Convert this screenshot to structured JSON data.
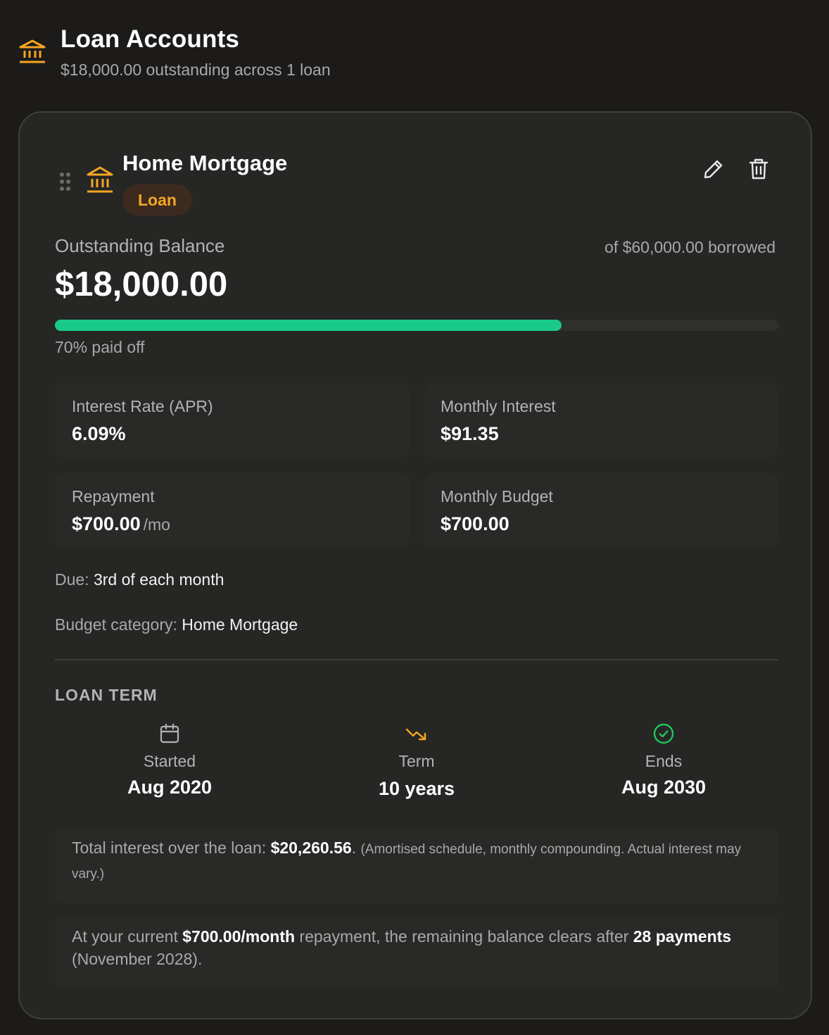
{
  "header": {
    "title": "Loan Accounts",
    "subtitle": "$18,000.00 outstanding across 1 loan"
  },
  "colors": {
    "accent": "#f5a623",
    "progress": "#19c98a",
    "success": "#22c55e",
    "background": "#1c1b1a",
    "card": "#262625"
  },
  "loan": {
    "name": "Home Mortgage",
    "type_badge": "Loan",
    "icon": "bank-icon",
    "actions": {
      "edit_icon": "pencil-icon",
      "delete_icon": "trash-icon"
    },
    "balance_label": "Outstanding Balance",
    "balance": "$18,000.00",
    "borrowed": "of $60,000.00 borrowed",
    "paid_fraction": 0.7,
    "paid_off_text": "70% paid off",
    "stats": {
      "interest_rate": {
        "label": "Interest Rate (APR)",
        "value": "6.09%"
      },
      "monthly_interest": {
        "label": "Monthly Interest",
        "value": "$91.35"
      },
      "repayment": {
        "label": "Repayment",
        "value": "$700.00",
        "unit": "/mo"
      },
      "monthly_budget": {
        "label": "Monthly Budget",
        "value": "$700.00"
      }
    },
    "due": {
      "label": "Due:",
      "value": "3rd of each month"
    },
    "budget_category": {
      "label": "Budget category:",
      "value": "Home Mortgage"
    },
    "term_section": {
      "title": "LOAN TERM",
      "started": {
        "icon": "calendar-icon",
        "label": "Started",
        "value": "Aug 2020"
      },
      "term": {
        "icon": "trending-down-icon",
        "label": "Term",
        "value": "10 years"
      },
      "ends": {
        "icon": "check-circle-icon",
        "label": "Ends",
        "value": "Aug 2030"
      }
    },
    "total_interest_note": {
      "prefix": "Total interest over the loan:",
      "amount": "$20,260.56",
      "suffix": ".",
      "disclaimer": "(Amortised schedule, monthly compounding. Actual interest may vary.)"
    },
    "payoff_note": {
      "prefix": "At your current",
      "amount": "$700.00/month",
      "middle": "repayment, the remaining balance clears after",
      "payments": "28 payments",
      "date": "(November 2028)."
    }
  }
}
